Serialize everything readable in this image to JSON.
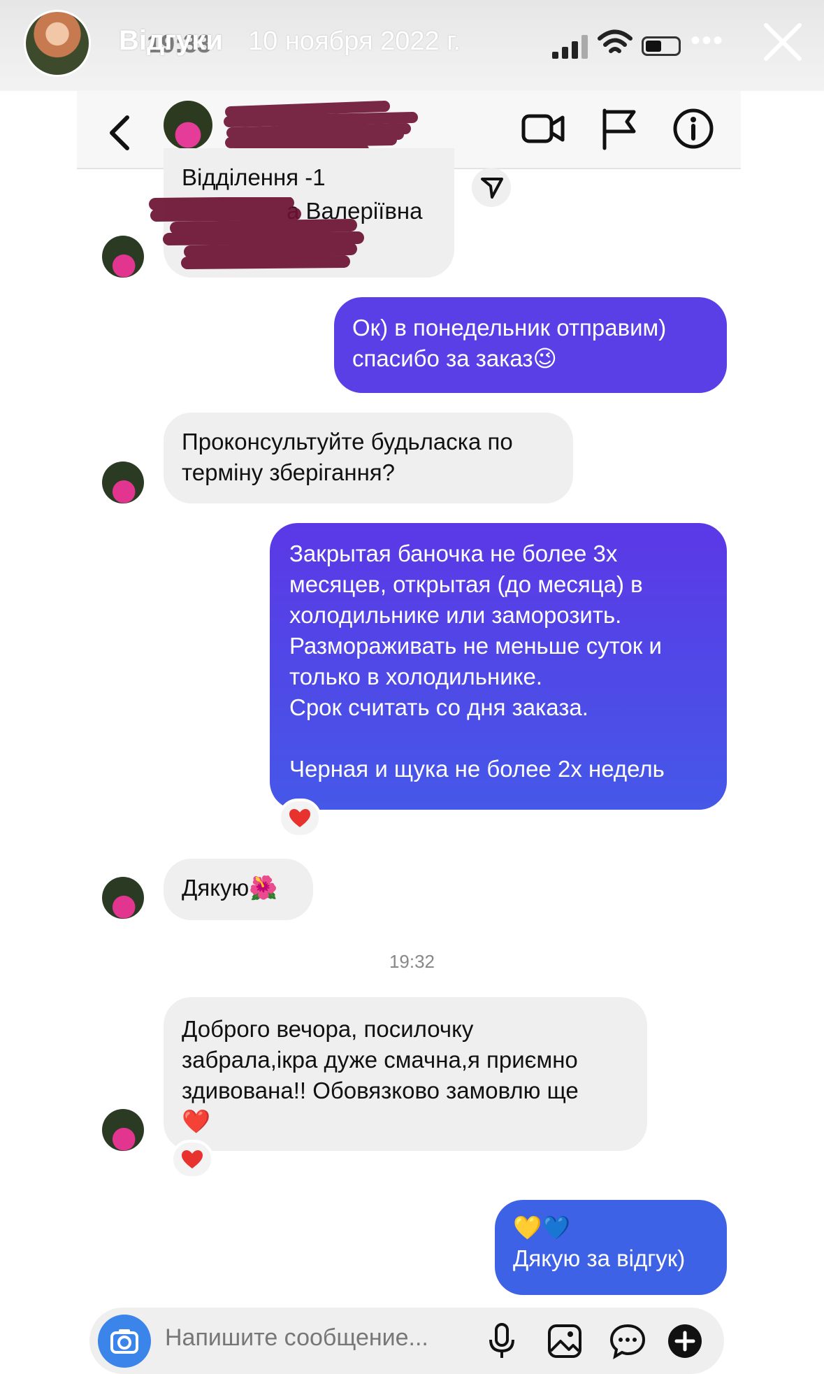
{
  "story": {
    "title": "Відгуки",
    "date": "10 ноября 2022 г.",
    "status_time": "19:33",
    "more": "•••"
  },
  "chat": {
    "messages": {
      "m0": {
        "line1": "Відділення  -1",
        "line2": "а Валеріївна"
      },
      "m1": {
        "text": "Ок) в понедельник отправим)\nспасибо за заказ😉"
      },
      "m2": {
        "text": "Проконсультуйте будьласка по\nтерміну зберігання?"
      },
      "m3": {
        "text": "Закрытая баночка не более 3х\nмесяцев, открытая (до месяца) в\nхолодильнике или заморозить.\nРазмораживать не меньше суток и\nтолько в холодильнике.\nСрок считать со дня заказа.\n\nЧерная и щука не более 2х недель"
      },
      "m4": {
        "text": "Дякую🌺"
      },
      "timestamp": "19:32",
      "m5": {
        "text": "Доброго вечора, посилочку\nзабрала,ікра дуже смачна,я приємно\nздивована!! Обовязково замовлю ще\n❤️"
      },
      "m6": {
        "text": "💛💙\nДякую за відгук)"
      }
    }
  },
  "composer": {
    "placeholder": "Напишите сообщение..."
  },
  "colors": {
    "bubble_in": "#efefef",
    "bubble_out_top": "#6338e6",
    "bubble_out_bottom": "#3b63e6",
    "redaction": "#6b1232",
    "heart": "#e8322d",
    "camera": "#3a84ea"
  },
  "icons": [
    "back-icon",
    "video-call-icon",
    "flag-icon",
    "info-icon",
    "share-icon",
    "camera-icon",
    "microphone-icon",
    "gallery-icon",
    "sticker-icon",
    "add-icon",
    "close-icon"
  ]
}
